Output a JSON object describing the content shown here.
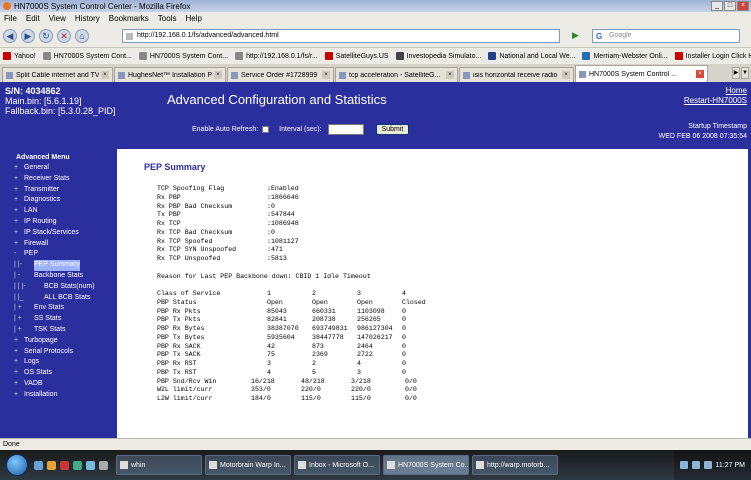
{
  "window": {
    "title": "HN7000S System Control Center - Mozilla Firefox"
  },
  "menubar": [
    "File",
    "Edit",
    "View",
    "History",
    "Bookmarks",
    "Tools",
    "Help"
  ],
  "navbar": {
    "url": "http://192.168.0.1/fs/advanced/advanced.html",
    "search_placeholder": "Google"
  },
  "bookmarks": [
    "Yahoo!",
    "HN7000S System Cont...",
    "HN7000S System Cont...",
    "http://192.168.0.1/fs/r...",
    "SatelliteGuys.US",
    "Investopedia Simulato...",
    "National and Local We...",
    "Merriam-Webster Onli...",
    "Installer Login Click H..."
  ],
  "tabs": [
    {
      "label": "Split Cable internet and TV ...",
      "active": false
    },
    {
      "label": "HughesNet™ Installation P...",
      "active": false
    },
    {
      "label": "Service Order #1728999",
      "active": false
    },
    {
      "label": "tcp acceleration - SatelliteG...",
      "active": false
    },
    {
      "label": "isis horizontal receive radio ...",
      "active": false
    },
    {
      "label": "HN7000S System Control ...",
      "active": true
    }
  ],
  "header": {
    "sn": "S/N: 4034862",
    "main_bin": "Main.bin: [5.6.1.19]",
    "fallback_bin": "Fallback.bin: [5.3.0.28_PID]",
    "title": "Advanced Configuration and Statistics",
    "home": "Home",
    "restart": "Restart-HN7000S",
    "auto_refresh": "Enable Auto Refresh:",
    "interval": "Interval (sec):",
    "submit": "Submit",
    "startup_label": "Startup Timestamp",
    "startup_time": "WED FEB 06 2008 07:35:54"
  },
  "sidebar": {
    "heading": "Advanced Menu",
    "items": [
      {
        "prefix": "+",
        "label": "General",
        "indent": 0
      },
      {
        "prefix": "+",
        "label": "Receiver Stats",
        "indent": 0
      },
      {
        "prefix": "+",
        "label": "Transmitter",
        "indent": 0
      },
      {
        "prefix": "+",
        "label": "Diagnostics",
        "indent": 0
      },
      {
        "prefix": "+",
        "label": "LAN",
        "indent": 0
      },
      {
        "prefix": "+",
        "label": "IP Routing",
        "indent": 0
      },
      {
        "prefix": "+",
        "label": "IP Stack/Services",
        "indent": 0
      },
      {
        "prefix": "+",
        "label": "Firewall",
        "indent": 0
      },
      {
        "prefix": "-",
        "label": "PEP",
        "indent": 0
      },
      {
        "prefix": "|  |-",
        "label": "PEP Summary",
        "indent": 1,
        "selected": true
      },
      {
        "prefix": "|  -",
        "label": "Backbone Stats",
        "indent": 1
      },
      {
        "prefix": "|     |  |-",
        "label": "BCB Stats(num)",
        "indent": 2
      },
      {
        "prefix": "|     |_",
        "label": "ALL BCB Stats",
        "indent": 2
      },
      {
        "prefix": "|  +",
        "label": "Env Stats",
        "indent": 1
      },
      {
        "prefix": "|  +",
        "label": "SS Stats",
        "indent": 1
      },
      {
        "prefix": "|  +",
        "label": "TSK Stats",
        "indent": 1
      },
      {
        "prefix": "+",
        "label": "Turbopage",
        "indent": 0
      },
      {
        "prefix": "+",
        "label": "Serial Protocols",
        "indent": 0
      },
      {
        "prefix": "+",
        "label": "Logs",
        "indent": 0
      },
      {
        "prefix": "+",
        "label": "OS Stats",
        "indent": 0
      },
      {
        "prefix": "+",
        "label": "VADB",
        "indent": 0
      },
      {
        "prefix": "+",
        "label": "Installation",
        "indent": 0
      }
    ]
  },
  "pep": {
    "heading": "PEP Summary",
    "stats": [
      [
        "TCP Spoofing Flag",
        ":Enabled"
      ],
      [
        "Rx PBP",
        ":1866646"
      ],
      [
        "Rx PBP Bad Checksum",
        ":0"
      ],
      [
        "Tx PBP",
        ":547844"
      ],
      [
        "Rx TCP",
        ":1086948"
      ],
      [
        "Rx TCP Bad Checksum",
        ":0"
      ],
      [
        "Rx TCP Spoofed",
        ":1081127"
      ],
      [
        "Rx TCP SYN Unspoofed",
        ":471"
      ],
      [
        "Rx TCP Unspoofed",
        ":5813"
      ]
    ],
    "reason": "Reason for Last PEP Backbone down: CBID 1 Idle Timeout",
    "table": [
      [
        "Class of Service",
        "1",
        "2",
        "3",
        "4"
      ],
      [
        "PBP Status",
        "Open",
        "Open",
        "Open",
        "Closed"
      ],
      [
        "PBP Rx Pkts",
        "85043",
        "660331",
        "1103098",
        "0"
      ],
      [
        "PBP Tx Pkts",
        "82841",
        "208738",
        "256265",
        "0"
      ],
      [
        "PBP Rx Bytes",
        "38387070",
        "693749831",
        "986127304",
        "0"
      ],
      [
        "PBP Tx Bytes",
        "5935604",
        "38447778",
        "147026217",
        "0"
      ],
      [
        "PBP Rx SACK",
        "42",
        "873",
        "2464",
        "0"
      ],
      [
        "PBP Tx SACK",
        "75",
        "2369",
        "2722",
        "0"
      ],
      [
        "PBP Rx RST",
        "3",
        "2",
        "4",
        "0"
      ],
      [
        "PBP Tx RST",
        "4",
        "5",
        "3",
        "0"
      ]
    ],
    "limits": [
      [
        "PBP Snd/Rcv Win",
        "16/218",
        "48/218",
        "3/218",
        "0/0"
      ],
      [
        "W2L limit/curr",
        "353/0",
        "220/0",
        "220/0",
        "0/0"
      ],
      [
        "L2W limit/curr",
        "184/0",
        "115/0",
        "115/0",
        "0/0"
      ]
    ]
  },
  "status": "Done",
  "taskbar": {
    "buttons": [
      {
        "label": "whin",
        "active": false
      },
      {
        "label": "Motorbrain Warp In...",
        "active": false
      },
      {
        "label": "Inbox - Microsoft O...",
        "active": false
      },
      {
        "label": "HN7000S System Co...",
        "active": true
      },
      {
        "label": "http://warp.motorb...",
        "active": false
      }
    ],
    "clock": "11:27 PM"
  }
}
